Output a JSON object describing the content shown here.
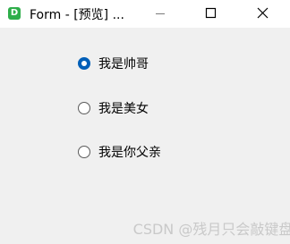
{
  "window": {
    "title": "Form - [预览] ...",
    "app_icon_letter": "D",
    "accent_color": "#005fb8",
    "icon_color": "#2eae4a"
  },
  "caption_buttons": {
    "minimize_icon": "minimize-icon",
    "maximize_icon": "maximize-icon",
    "close_icon": "close-icon"
  },
  "radios": [
    {
      "label": "我是帅哥",
      "checked": true
    },
    {
      "label": "我是美女",
      "checked": false
    },
    {
      "label": "我是你父亲",
      "checked": false
    }
  ],
  "watermark": "CSDN @残月只会敲键盘"
}
